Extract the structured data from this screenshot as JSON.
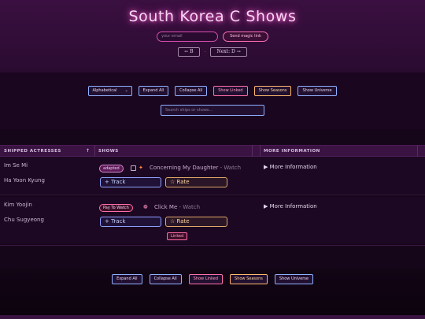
{
  "header": {
    "title": "South Korea C Shows",
    "email_placeholder": "your email",
    "magic_link_label": "Send magic link",
    "prev_label": "← B",
    "separator": "·",
    "next_label": "Next: D →"
  },
  "controls": {
    "sort_value": "Alphabetical",
    "sort_chevron": "⌄",
    "expand_all": "Expand All",
    "collapse_all": "Collapse All",
    "show_linked": "Show Linked",
    "show_seasons": "Show Seasons",
    "show_universe": "Show Universe",
    "search_placeholder": "Search ships or shows..."
  },
  "table": {
    "headers": {
      "actresses": "SHIPPED ACTRESSES",
      "actresses_sort": "↑",
      "shows": "SHOWS",
      "more_info": "MORE INFORMATION"
    },
    "rows": [
      {
        "actress_1": "Im Se Mi",
        "actress_2": "Ha Yoon Kyung",
        "tag": "adapted",
        "show": "Concerning My Daughter",
        "watch": " - Watch",
        "track_label": "+ Track",
        "rate_label": "☆ Rate",
        "more_label": "▶ More Information"
      },
      {
        "actress_1": "Kim Yoojin",
        "actress_2": "Chu Sugyeong",
        "tag": "Pay To Watch",
        "show": "Click Me",
        "watch": " - Watch",
        "track_label": "+ Track",
        "rate_label": "☆ Rate",
        "more_label": "▶ More Information",
        "linked_label": "Linked"
      }
    ]
  },
  "footer_controls": {
    "expand_all": "Expand All",
    "collapse_all": "Collapse All",
    "show_linked": "Show Linked",
    "show_seasons": "Show Seasons",
    "show_universe": "Show Universe"
  },
  "icons": {
    "book": "book-icon",
    "fire": "fire-icon",
    "brain": "brain-icon"
  },
  "colors": {
    "accent_pink": "#ff6fa8",
    "accent_blue": "#8fb0ff",
    "accent_orange": "#ffb86c",
    "background": "#16061a"
  }
}
